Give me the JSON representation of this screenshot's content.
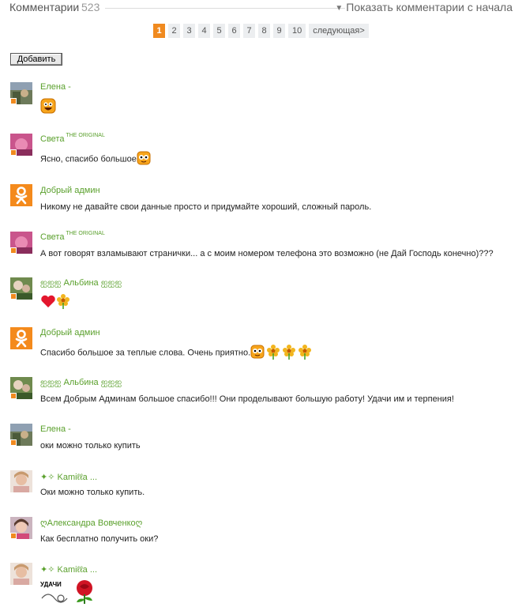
{
  "header": {
    "title": "Комментарии",
    "count": "523",
    "show_from_start": "Показать комментарии с начала"
  },
  "pager": {
    "current": "1",
    "pages": [
      "2",
      "3",
      "4",
      "5",
      "6",
      "7",
      "8",
      "9",
      "10"
    ],
    "next": "следующая>"
  },
  "add_button": "Добавить",
  "comments": [
    {
      "author": "Елена -",
      "text": "",
      "emoji": [
        "smiley-grin-icon"
      ]
    },
    {
      "author": "Света",
      "author_sup": "THE ORIGINAL",
      "text": "Ясно, спасибо большое",
      "emoji": [
        "smiley-icon"
      ]
    },
    {
      "author": "Добрый админ",
      "text": "Никому не давайте свои данные просто и придумайте хороший, сложный пароль."
    },
    {
      "author": "Света",
      "author_sup": "THE ORIGINAL",
      "text": "А вот говорят взламывают странички... а с моим номером телефона это возможно (не Дай Господь конечно)???"
    },
    {
      "author": "ஐஐஐ Альбина ஐஐஐ",
      "text": "",
      "emoji": [
        "heart-icon",
        "flower-icon"
      ]
    },
    {
      "author": "Добрый админ",
      "text": "Спасибо большое за теплые слова. Очень приятно.",
      "emoji": [
        "smiley-icon",
        "flower-icon",
        "flower-icon",
        "flower-icon"
      ]
    },
    {
      "author": "ஐஐஐ Альбина ஐஐஐ",
      "text": "Всем Добрым Админам большое спасибо!!! Они проделывают большую работу! Удачи им и терпения!"
    },
    {
      "author": "Елена -",
      "text": "оки можно только купить"
    },
    {
      "author": "✦✧ Kamiℓℓa ...",
      "text": "Оки можно только купить."
    },
    {
      "author": "ღАлександра Вовченкоღ",
      "text": "Как бесплатно получить оки?"
    },
    {
      "author": "✦✧ Kamiℓℓa ...",
      "text": "",
      "sticker_text": "УДАЧИ",
      "emoji": [
        "rose-icon"
      ]
    }
  ],
  "colors": {
    "accent": "#f08a1f",
    "author": "#5aa02c",
    "pager_bg": "#eceef0"
  }
}
